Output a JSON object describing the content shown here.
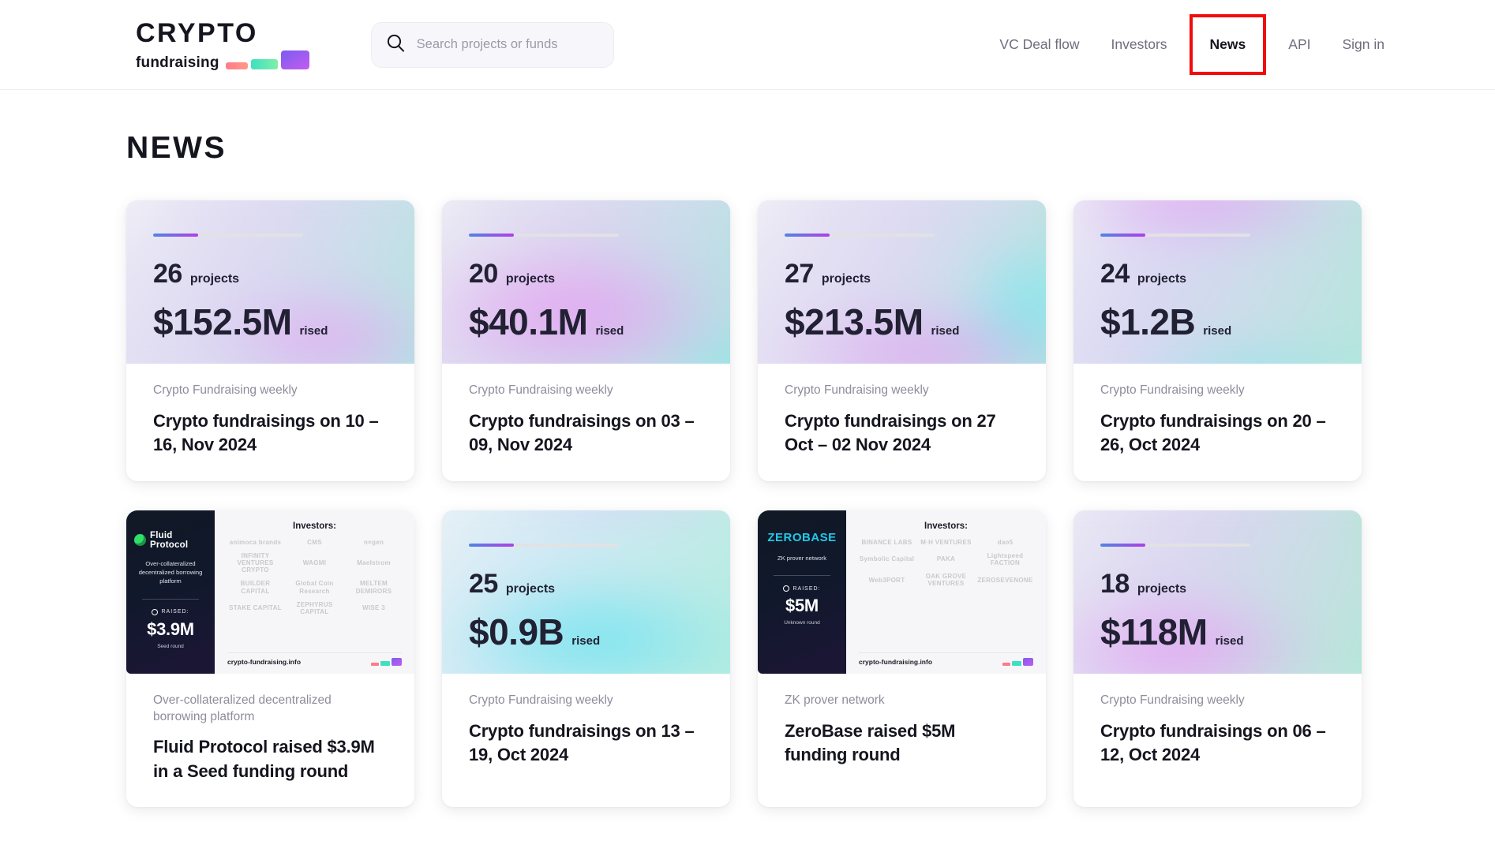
{
  "brand": {
    "logo_top": "CRYPTO",
    "logo_bottom": "fundraising"
  },
  "search": {
    "placeholder": "Search projects or funds",
    "value": "",
    "icon": "search-icon"
  },
  "nav": {
    "items": [
      {
        "label": "VC Deal flow",
        "active": false,
        "highlighted": false
      },
      {
        "label": "Investors",
        "active": false,
        "highlighted": false
      },
      {
        "label": "News",
        "active": true,
        "highlighted": true
      },
      {
        "label": "API",
        "active": false,
        "highlighted": false
      },
      {
        "label": "Sign in",
        "active": false,
        "highlighted": false
      }
    ],
    "highlight_color": "#f10b0b"
  },
  "page": {
    "title": "NEWS"
  },
  "cards": [
    {
      "type": "stat",
      "projects": "26",
      "projects_label": "projects",
      "raised": "$152.5M",
      "raised_label": "rised",
      "kicker": "Crypto Fundraising weekly",
      "title": "Crypto fundraisings on 10 – 16, Nov 2024",
      "progress_pct": 30
    },
    {
      "type": "stat",
      "projects": "20",
      "projects_label": "projects",
      "raised": "$40.1M",
      "raised_label": "rised",
      "kicker": "Crypto Fundraising weekly",
      "title": "Crypto fundraisings on 03 – 09, Nov 2024",
      "progress_pct": 30
    },
    {
      "type": "stat",
      "projects": "27",
      "projects_label": "projects",
      "raised": "$213.5M",
      "raised_label": "rised",
      "kicker": "Crypto Fundraising weekly",
      "title": "Crypto fundraisings on 27 Oct – 02 Nov 2024",
      "progress_pct": 30
    },
    {
      "type": "stat",
      "projects": "24",
      "projects_label": "projects",
      "raised": "$1.2B",
      "raised_label": "rised",
      "kicker": "Crypto Fundraising weekly",
      "title": "Crypto fundraisings on 20 – 26, Oct 2024",
      "progress_pct": 30
    },
    {
      "type": "project",
      "project_name": "Fluid Protocol",
      "project_desc": "Over-collateralized decentralized borrowing platform",
      "raised_caption": "RAISED:",
      "raised_amount": "$3.9M",
      "round": "Seed round",
      "investors_title": "Investors:",
      "investors": [
        "animoca brands",
        "CMS",
        "n×gen",
        "INFINITY VENTURES CRYPTO",
        "WAGMI",
        "Maelstrom",
        "BUILDER CAPITAL",
        "Global Coin Research",
        "MELTEM DEMIRORS",
        "STAKE CAPITAL",
        "ZEPHYRUS CAPITAL",
        "WISE 3"
      ],
      "footer_url": "crypto-fundraising.info",
      "kicker": "Over-collateralized decentralized borrowing platform",
      "title": "Fluid Protocol raised $3.9M in a Seed funding round"
    },
    {
      "type": "stat",
      "projects": "25",
      "projects_label": "projects",
      "raised": "$0.9B",
      "raised_label": "rised",
      "kicker": "Crypto Fundraising weekly",
      "title": "Crypto fundraisings on 13 – 19, Oct 2024",
      "progress_pct": 30
    },
    {
      "type": "project",
      "project_name": "ZEROBASE",
      "project_desc": "ZK prover network",
      "raised_caption": "RAISED:",
      "raised_amount": "$5M",
      "round": "Unknown round",
      "investors_title": "Investors:",
      "investors": [
        "BINANCE LABS",
        "M·H VENTURES",
        "dao5",
        "Symbolic Capital",
        "PAKA",
        "Lightspeed FACTION",
        "Web3PORT",
        "OAK GROVE VENTURES",
        "ZEROSEVENONE"
      ],
      "footer_url": "crypto-fundraising.info",
      "kicker": "ZK prover network",
      "title": "ZeroBase raised $5M funding round"
    },
    {
      "type": "stat",
      "projects": "18",
      "projects_label": "projects",
      "raised": "$118M",
      "raised_label": "rised",
      "kicker": "Crypto Fundraising weekly",
      "title": "Crypto fundraisings on 06 – 12, Oct 2024",
      "progress_pct": 30
    }
  ],
  "colors": {
    "accent_purple": "#b040e8",
    "accent_blue": "#4f86e0",
    "text_dark": "#15151f",
    "text_muted": "#8d8d9c",
    "highlight_red": "#f10b0b"
  }
}
